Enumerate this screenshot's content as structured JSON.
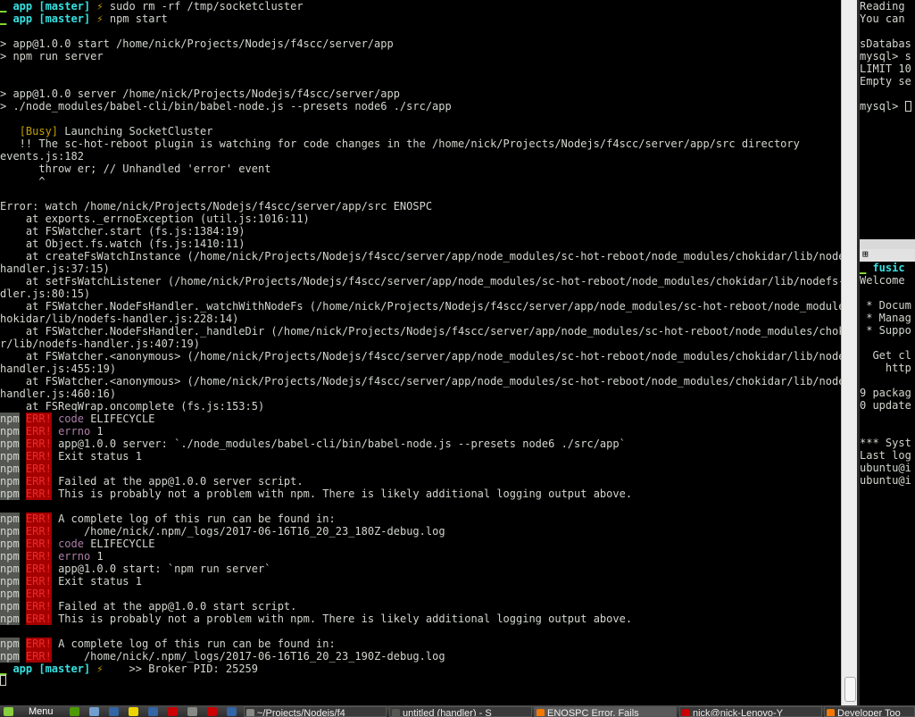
{
  "main_terminal": {
    "prompt_label": "app [master]",
    "lines": [
      {
        "t": "prompt",
        "cmd": "sudo rm -rf /tmp/socketcluster"
      },
      {
        "t": "prompt",
        "cmd": "npm start"
      },
      {
        "t": "text",
        "text": ""
      },
      {
        "t": "text",
        "text": "> app@1.0.0 start /home/nick/Projects/Nodejs/f4scc/server/app"
      },
      {
        "t": "text",
        "text": "> npm run server"
      },
      {
        "t": "text",
        "text": ""
      },
      {
        "t": "text",
        "text": ""
      },
      {
        "t": "text",
        "text": "> app@1.0.0 server /home/nick/Projects/Nodejs/f4scc/server/app"
      },
      {
        "t": "text",
        "text": "> ./node_modules/babel-cli/bin/babel-node.js --presets node6 ./src/app"
      },
      {
        "t": "text",
        "text": ""
      },
      {
        "t": "busy",
        "tag": "[Busy]",
        "text": " Launching SocketCluster"
      },
      {
        "t": "text",
        "text": "   !! The sc-hot-reboot plugin is watching for code changes in the /home/nick/Projects/Nodejs/f4scc/server/app/src directory"
      },
      {
        "t": "text",
        "text": "events.js:182"
      },
      {
        "t": "text",
        "text": "      throw er; // Unhandled 'error' event"
      },
      {
        "t": "text",
        "text": "      ^"
      },
      {
        "t": "text",
        "text": ""
      },
      {
        "t": "text",
        "text": "Error: watch /home/nick/Projects/Nodejs/f4scc/server/app/src ENOSPC"
      },
      {
        "t": "text",
        "text": "    at exports._errnoException (util.js:1016:11)"
      },
      {
        "t": "text",
        "text": "    at FSWatcher.start (fs.js:1384:19)"
      },
      {
        "t": "text",
        "text": "    at Object.fs.watch (fs.js:1410:11)"
      },
      {
        "t": "text",
        "text": "    at createFsWatchInstance (/home/nick/Projects/Nodejs/f4scc/server/app/node_modules/sc-hot-reboot/node_modules/chokidar/lib/nodefs-"
      },
      {
        "t": "text",
        "text": "handler.js:37:15)"
      },
      {
        "t": "text",
        "text": "    at setFsWatchListener (/home/nick/Projects/Nodejs/f4scc/server/app/node_modules/sc-hot-reboot/node_modules/chokidar/lib/nodefs-han"
      },
      {
        "t": "text",
        "text": "dler.js:80:15)"
      },
      {
        "t": "text",
        "text": "    at FSWatcher.NodeFsHandler._watchWithNodeFs (/home/nick/Projects/Nodejs/f4scc/server/app/node_modules/sc-hot-reboot/node_modules/c"
      },
      {
        "t": "text",
        "text": "hokidar/lib/nodefs-handler.js:228:14)"
      },
      {
        "t": "text",
        "text": "    at FSWatcher.NodeFsHandler._handleDir (/home/nick/Projects/Nodejs/f4scc/server/app/node_modules/sc-hot-reboot/node_modules/chokida"
      },
      {
        "t": "text",
        "text": "r/lib/nodefs-handler.js:407:19)"
      },
      {
        "t": "text",
        "text": "    at FSWatcher.<anonymous> (/home/nick/Projects/Nodejs/f4scc/server/app/node_modules/sc-hot-reboot/node_modules/chokidar/lib/nodefs-"
      },
      {
        "t": "text",
        "text": "handler.js:455:19)"
      },
      {
        "t": "text",
        "text": "    at FSWatcher.<anonymous> (/home/nick/Projects/Nodejs/f4scc/server/app/node_modules/sc-hot-reboot/node_modules/chokidar/lib/nodefs-"
      },
      {
        "t": "text",
        "text": "handler.js:460:16)"
      },
      {
        "t": "text",
        "text": "    at FSReqWrap.oncomplete (fs.js:153:5)"
      },
      {
        "t": "npm",
        "key": "code",
        "text": " ELIFECYCLE"
      },
      {
        "t": "npm",
        "key": "errno",
        "text": " 1"
      },
      {
        "t": "npm",
        "text": "app@1.0.0 server: `./node_modules/babel-cli/bin/babel-node.js --presets node6 ./src/app`"
      },
      {
        "t": "npm",
        "text": "Exit status 1"
      },
      {
        "t": "npm",
        "text": ""
      },
      {
        "t": "npm",
        "text": "Failed at the app@1.0.0 server script."
      },
      {
        "t": "npm",
        "text": "This is probably not a problem with npm. There is likely additional logging output above."
      },
      {
        "t": "text",
        "text": ""
      },
      {
        "t": "npm",
        "text": "A complete log of this run can be found in:"
      },
      {
        "t": "npm",
        "text": "    /home/nick/.npm/_logs/2017-06-16T16_20_23_180Z-debug.log"
      },
      {
        "t": "npm",
        "key": "code",
        "text": " ELIFECYCLE"
      },
      {
        "t": "npm",
        "key": "errno",
        "text": " 1"
      },
      {
        "t": "npm",
        "text": "app@1.0.0 start: `npm run server`"
      },
      {
        "t": "npm",
        "text": "Exit status 1"
      },
      {
        "t": "npm",
        "text": ""
      },
      {
        "t": "npm",
        "text": "Failed at the app@1.0.0 start script."
      },
      {
        "t": "npm",
        "text": "This is probably not a problem with npm. There is likely additional logging output above."
      },
      {
        "t": "text",
        "text": ""
      },
      {
        "t": "npm",
        "text": "A complete log of this run can be found in:"
      },
      {
        "t": "npm",
        "text": "    /home/nick/.npm/_logs/2017-06-16T16_20_23_190Z-debug.log"
      },
      {
        "t": "prompt",
        "cmd": "   >> Broker PID: 25259"
      }
    ],
    "npm_label": "npm",
    "err_label": "ERR!",
    "prompt_sym": "⚡"
  },
  "right_top_terminal": {
    "lines": [
      "Reading",
      "You can",
      "",
      "sDatabas",
      "mysql> s",
      "LIMIT 10",
      "Empty se",
      "",
      "mysql> "
    ]
  },
  "right_bottom_terminal": {
    "lines": [
      {
        "t": "prompt",
        "text": "fusic"
      },
      {
        "t": "text",
        "text": "Welcome"
      },
      {
        "t": "text",
        "text": ""
      },
      {
        "t": "text",
        "text": " * Docum"
      },
      {
        "t": "text",
        "text": " * Manag"
      },
      {
        "t": "text",
        "text": " * Suppo"
      },
      {
        "t": "text",
        "text": ""
      },
      {
        "t": "text",
        "text": "  Get cl"
      },
      {
        "t": "text",
        "text": "    http"
      },
      {
        "t": "text",
        "text": ""
      },
      {
        "t": "text",
        "text": "9 packag"
      },
      {
        "t": "text",
        "text": "0 update"
      },
      {
        "t": "text",
        "text": ""
      },
      {
        "t": "text",
        "text": ""
      },
      {
        "t": "text",
        "text": "*** Syst"
      },
      {
        "t": "text",
        "text": "Last log"
      },
      {
        "t": "text",
        "text": "ubuntu@i"
      },
      {
        "t": "text",
        "text": "ubuntu@i"
      }
    ]
  },
  "taskbar": {
    "menu_label": "Menu",
    "tasks": [
      {
        "label": "~/Projects/Nodejs/f4",
        "icon_color": "#888a85",
        "active": false
      },
      {
        "label": "untitled (handler) - S",
        "icon_color": "#555753",
        "active": false
      },
      {
        "label": "ENOSPC Error, Fails",
        "icon_color": "#f57900",
        "active": true
      },
      {
        "label": "nick@nick-Lenovo-Y",
        "icon_color": "#cc0000",
        "active": false
      },
      {
        "label": "Developer Too",
        "icon_color": "#f57900",
        "active": false
      }
    ],
    "quick_launch_colors": [
      "#4e9a06",
      "#729fcf",
      "#3465a4",
      "#edd400",
      "#3465a4",
      "#cc0000",
      "#888a85",
      "#cc0000",
      "#3465a4"
    ]
  }
}
